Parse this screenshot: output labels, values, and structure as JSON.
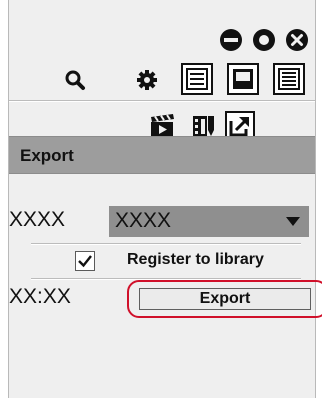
{
  "window_controls": [
    {
      "name": "minimize-icon"
    },
    {
      "name": "restore-icon"
    },
    {
      "name": "close-icon"
    }
  ],
  "toolbar_icons": [
    {
      "name": "search-icon"
    },
    {
      "name": "gear-icon"
    },
    {
      "name": "list-view-icon"
    },
    {
      "name": "thumbnail-view-icon"
    },
    {
      "name": "detail-view-icon"
    }
  ],
  "mode_icons": [
    {
      "name": "clapper-icon"
    },
    {
      "name": "film-edit-icon"
    },
    {
      "name": "export-mode-icon"
    }
  ],
  "section": {
    "title": "Export"
  },
  "format_row": {
    "label": "XXXX",
    "selected": "XXXX"
  },
  "register": {
    "label": "Register to library",
    "checked": true
  },
  "export_row": {
    "label": "XX:XX",
    "button": "Export"
  },
  "colors": {
    "highlight": "#d0102a",
    "header_bg": "#9d9d9d",
    "panel_bg": "#efefef"
  }
}
